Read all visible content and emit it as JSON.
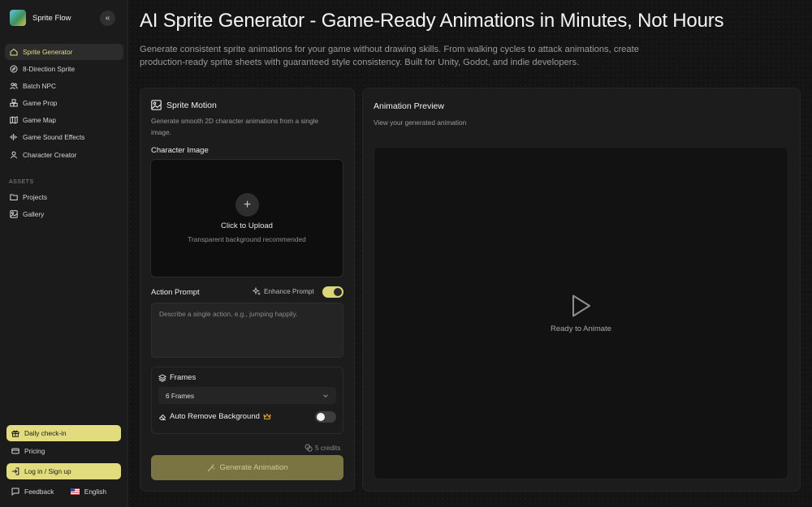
{
  "sidebar": {
    "brand": "Sprite Flow",
    "items": [
      {
        "label": "Sprite Generator",
        "icon": "home-icon",
        "active": true
      },
      {
        "label": "8-Direction Sprite",
        "icon": "compass-icon"
      },
      {
        "label": "Batch NPC",
        "icon": "users-icon"
      },
      {
        "label": "Game Prop",
        "icon": "boxes-icon"
      },
      {
        "label": "Game Map",
        "icon": "map-icon"
      },
      {
        "label": "Game Sound Effects",
        "icon": "audio-wave-icon"
      },
      {
        "label": "Character Creator",
        "icon": "user-icon"
      }
    ],
    "assets_label": "ASSETS",
    "assets": [
      {
        "label": "Projects",
        "icon": "folder-icon"
      },
      {
        "label": "Gallery",
        "icon": "image-icon"
      }
    ],
    "daily_checkin": "Daily check-in",
    "pricing": "Pricing",
    "login": "Log in / Sign up",
    "feedback": "Feedback",
    "language": "English"
  },
  "header": {
    "title": "AI Sprite Generator - Game-Ready Animations in Minutes, Not Hours",
    "subtitle": "Generate consistent sprite animations for your game without drawing skills. From walking cycles to attack animations, create production-ready sprite sheets with guaranteed style consistency. Built for Unity, Godot, and indie developers."
  },
  "form": {
    "title": "Sprite Motion",
    "description": "Generate smooth 2D character animations from a single image.",
    "character_image_label": "Character Image",
    "upload_title": "Click to Upload",
    "upload_hint": "Transparent background recommended",
    "action_prompt_label": "Action Prompt",
    "enhance_prompt_label": "Enhance Prompt",
    "enhance_prompt_on": true,
    "prompt_placeholder": "Describe a single action, e.g., jumping happily.",
    "prompt_value": "",
    "frames_label": "Frames",
    "frames_value": "6 Frames",
    "auto_remove_bg_label": "Auto Remove Background",
    "auto_remove_bg_on": false,
    "credits": "5 credits",
    "generate_label": "Generate Animation"
  },
  "preview": {
    "title": "Animation Preview",
    "description": "View your generated animation",
    "status": "Ready to Animate"
  },
  "colors": {
    "accent": "#e2dc7f",
    "generate_button": "#7a7442",
    "background": "#141414",
    "card": "#1c1c1c"
  }
}
